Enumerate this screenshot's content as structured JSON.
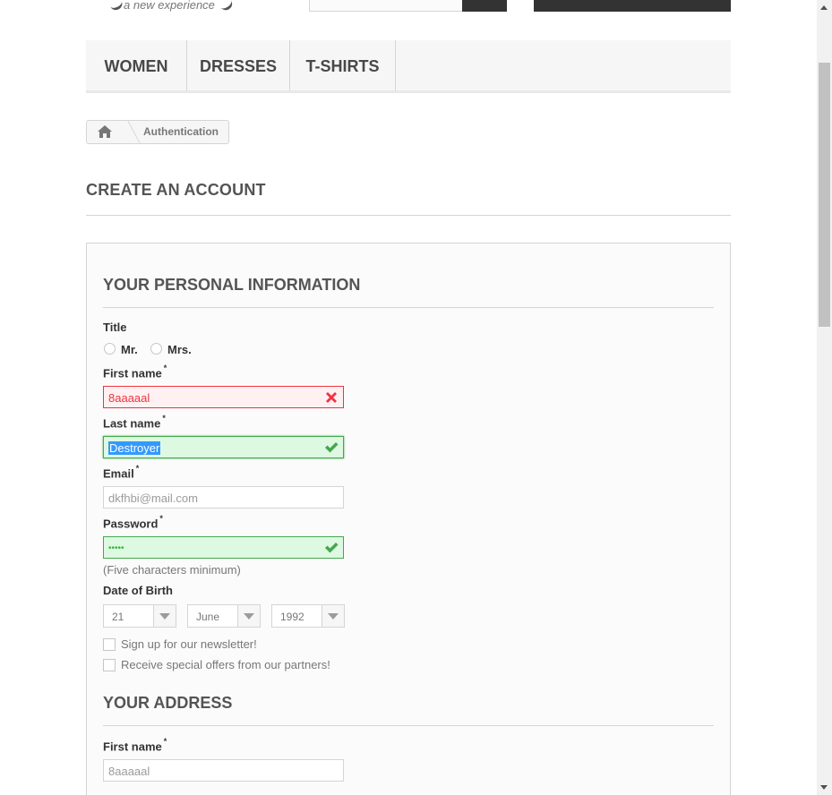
{
  "header": {
    "logo_tagline": "a new experience"
  },
  "menu": {
    "items": [
      {
        "label": "WOMEN"
      },
      {
        "label": "DRESSES"
      },
      {
        "label": "T-SHIRTS"
      }
    ]
  },
  "breadcrumb": {
    "home_icon": "home-icon",
    "current": "Authentication"
  },
  "page": {
    "heading": "CREATE AN ACCOUNT"
  },
  "personal": {
    "title": "YOUR PERSONAL INFORMATION",
    "title_label": "Title",
    "mr_label": "Mr.",
    "mrs_label": "Mrs.",
    "first_name_label": "First name",
    "first_name_value": "8aaaaal",
    "last_name_label": "Last name",
    "last_name_value": "Destroyer",
    "email_label": "Email",
    "email_value": "dkfhbi@mail.com",
    "password_label": "Password",
    "password_value": "•••••",
    "password_hint": "(Five characters minimum)",
    "dob_label": "Date of Birth",
    "dob_day": "21",
    "dob_month": "June",
    "dob_year": "1992",
    "newsletter_label": "Sign up for our newsletter!",
    "offers_label": "Receive special offers from our partners!",
    "required_mark": "*"
  },
  "address": {
    "title": "YOUR ADDRESS",
    "first_name_label": "First name",
    "first_name_value": "8aaaaal"
  },
  "colors": {
    "error": "#f13340",
    "success": "#46a74e",
    "dark": "#333333"
  }
}
